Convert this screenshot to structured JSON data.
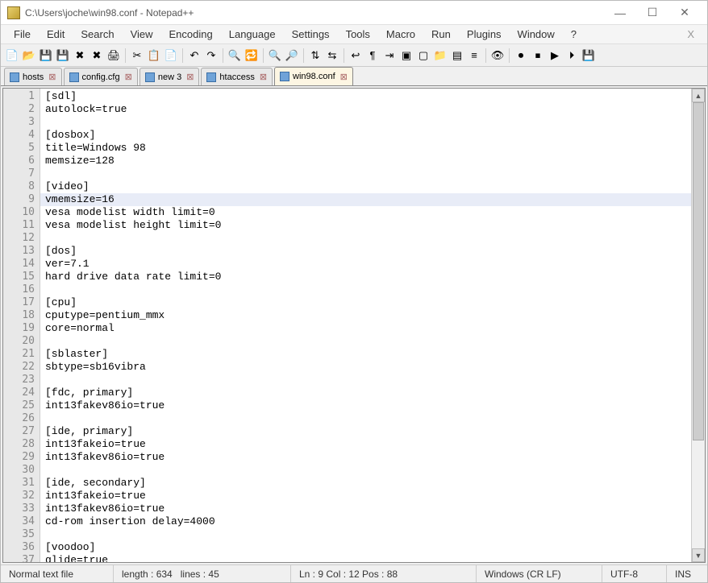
{
  "window": {
    "title": "C:\\Users\\joche\\win98.conf - Notepad++"
  },
  "menu": {
    "items": [
      "File",
      "Edit",
      "Search",
      "View",
      "Encoding",
      "Language",
      "Settings",
      "Tools",
      "Macro",
      "Run",
      "Plugins",
      "Window",
      "?"
    ],
    "mdi_close": "X"
  },
  "toolbar_icons": [
    "new",
    "open",
    "save",
    "save-all",
    "close",
    "close-all",
    "print",
    "|",
    "cut",
    "copy",
    "paste",
    "|",
    "undo",
    "redo",
    "|",
    "find",
    "replace",
    "|",
    "zoom-in",
    "zoom-out",
    "|",
    "sync-v",
    "sync-h",
    "|",
    "wrap",
    "all-chars",
    "indent",
    "fold",
    "unfold",
    "folder",
    "doc-map",
    "func-list",
    "|",
    "eye",
    "|",
    "record",
    "stop",
    "play",
    "play2",
    "save-macro"
  ],
  "tabs": [
    {
      "label": "hosts",
      "active": false
    },
    {
      "label": "config.cfg",
      "active": false
    },
    {
      "label": "new 3",
      "active": false
    },
    {
      "label": "htaccess",
      "active": false
    },
    {
      "label": "win98.conf",
      "active": true
    }
  ],
  "editor": {
    "highlighted_line": 9,
    "lines": [
      "[sdl]",
      "autolock=true",
      "",
      "[dosbox]",
      "title=Windows 98",
      "memsize=128",
      "",
      "[video]",
      "vmemsize=16",
      "vesa modelist width limit=0",
      "vesa modelist height limit=0",
      "",
      "[dos]",
      "ver=7.1",
      "hard drive data rate limit=0",
      "",
      "[cpu]",
      "cputype=pentium_mmx",
      "core=normal",
      "",
      "[sblaster]",
      "sbtype=sb16vibra",
      "",
      "[fdc, primary]",
      "int13fakev86io=true",
      "",
      "[ide, primary]",
      "int13fakeio=true",
      "int13fakev86io=true",
      "",
      "[ide, secondary]",
      "int13fakeio=true",
      "int13fakev86io=true",
      "cd-rom insertion delay=4000",
      "",
      "[voodoo]",
      "glide=true"
    ]
  },
  "status": {
    "filetype": "Normal text file",
    "length_label": "length : 634",
    "lines_label": "lines : 45",
    "pos_label": "Ln : 9    Col : 12    Pos : 88",
    "eol": "Windows (CR LF)",
    "encoding": "UTF-8",
    "mode": "INS"
  }
}
